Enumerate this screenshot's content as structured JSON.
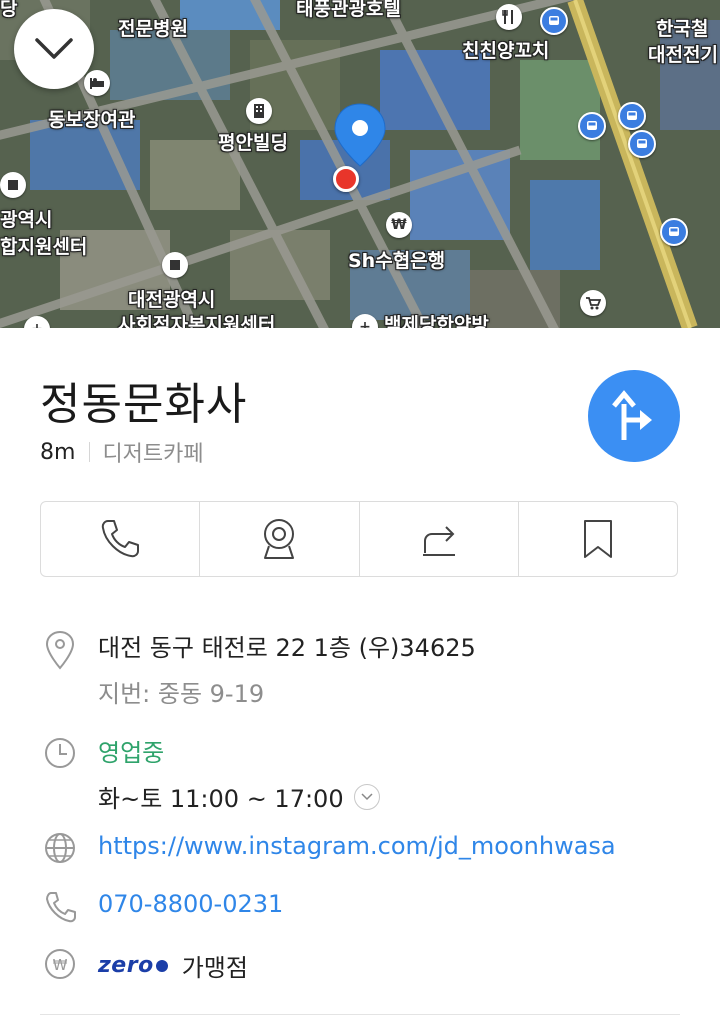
{
  "map": {
    "labels": {
      "hospital": "전문병원",
      "hospital_prefix": "당",
      "hotel_top": "태풍관광호텔",
      "restaurant": "친친양꼬치",
      "railway": "한국철",
      "railway2": "대전전기",
      "inn": "동보장여관",
      "building": "평안빌딩",
      "city_left": "광역시",
      "support_center": "합지원센터",
      "bank": "Sh수협은행",
      "city_hall": "대전광역시",
      "social_center": "사회적자본지원센터",
      "pharmacy": "백제당한약방"
    },
    "icons": [
      "chevron-down-icon",
      "location-pin-icon",
      "bus-icon",
      "restaurant-icon",
      "bank-icon",
      "shopping-cart-icon"
    ]
  },
  "place": {
    "name": "정동문화사",
    "distance": "8m",
    "category": "디저트카페"
  },
  "details": {
    "address": "대전 동구 태전로 22 1층 (우)34625",
    "lot_address": "지번: 중동 9-19",
    "status": "영업중",
    "hours": "화~토 11:00 ~ 17:00",
    "website": "https://www.instagram.com/jd_moonhwasa",
    "phone": "070-8800-0231",
    "zeropay_logo": "zero",
    "zeropay_label": "가맹점"
  },
  "colors": {
    "accent": "#3b8ff3",
    "open_status": "#2fa36b",
    "link": "#2f86e8",
    "pin_red": "#e8352a"
  }
}
